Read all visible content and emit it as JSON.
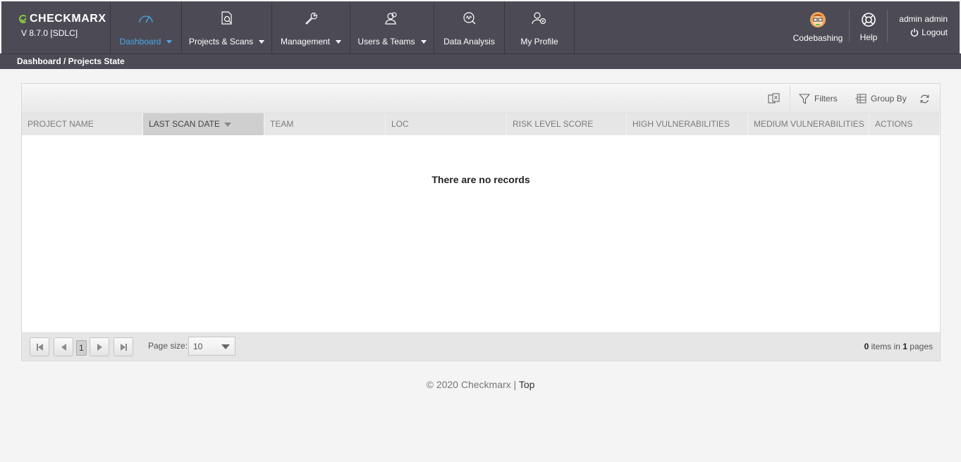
{
  "header": {
    "logo_text": "CHECKMARX",
    "version": "V 8.7.0  [SDLC]",
    "nav": [
      {
        "label": "Dashboard",
        "icon": "gauge-icon",
        "has_caret": true,
        "active": true
      },
      {
        "label": "Projects & Scans",
        "icon": "document-search-icon",
        "has_caret": true,
        "active": false
      },
      {
        "label": "Management",
        "icon": "wrench-icon",
        "has_caret": true,
        "active": false
      },
      {
        "label": "Users & Teams",
        "icon": "users-icon",
        "has_caret": true,
        "active": false
      },
      {
        "label": "Data Analysis",
        "icon": "analysis-icon",
        "has_caret": false,
        "active": false
      },
      {
        "label": "My Profile",
        "icon": "profile-gear-icon",
        "has_caret": false,
        "active": false
      }
    ],
    "codebashing_label": "Codebashing",
    "help_label": "Help",
    "user_name": "admin admin",
    "logout_label": "Logout"
  },
  "breadcrumb": "Dashboard / Projects State",
  "toolbar": {
    "filters_label": "Filters",
    "group_by_label": "Group By"
  },
  "table": {
    "columns": [
      "PROJECT NAME",
      "LAST SCAN DATE",
      "TEAM",
      "LOC",
      "RISK LEVEL SCORE",
      "HIGH VULNERABILITIES",
      "MEDIUM VULNERABILITIES",
      "ACTIONS"
    ],
    "sorted_column": "LAST SCAN DATE",
    "empty_message": "There are no records"
  },
  "pager": {
    "current_page": "1",
    "page_size_label": "Page size:",
    "page_size": "10",
    "items_count": "0",
    "items_in_text": " items in ",
    "pages_count": "1",
    "pages_text": " pages"
  },
  "footer": {
    "copyright": "© 2020 Checkmarx | ",
    "top_link": "Top"
  },
  "colors": {
    "header_bg": "#4c4b55",
    "active_nav": "#4ba6e8",
    "logo_accent": "#8cc63f"
  }
}
